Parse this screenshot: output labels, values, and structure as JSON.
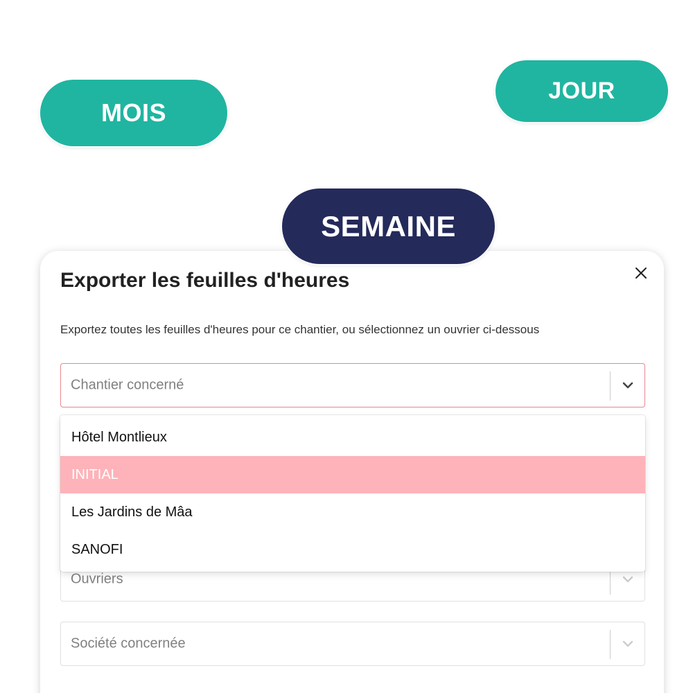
{
  "colors": {
    "teal": "#20b5a1",
    "navy": "#242a5a",
    "highlight": "#fdb3b9",
    "active_border": "#e9868d"
  },
  "tabs": {
    "mois": "MOIS",
    "jour": "JOUR",
    "semaine": "SEMAINE",
    "selected": "SEMAINE"
  },
  "modal": {
    "title": "Exporter les feuilles d'heures",
    "description": "Exportez toutes les feuilles d'heures pour ce chantier, ou sélectionnez un ouvrier ci-dessous",
    "close_icon": "close-icon",
    "chantier_select": {
      "placeholder": "Chantier concerné",
      "icon": "chevron-down-icon",
      "options": [
        "Hôtel Montlieux",
        "INITIAL",
        "Les Jardins de Mâa",
        "SANOFI"
      ],
      "highlighted": "INITIAL"
    },
    "ouvriers_select": {
      "placeholder": "Ouvriers",
      "icon": "chevron-down-icon"
    },
    "societe_select": {
      "placeholder": "Société concernée",
      "icon": "chevron-down-icon"
    }
  }
}
